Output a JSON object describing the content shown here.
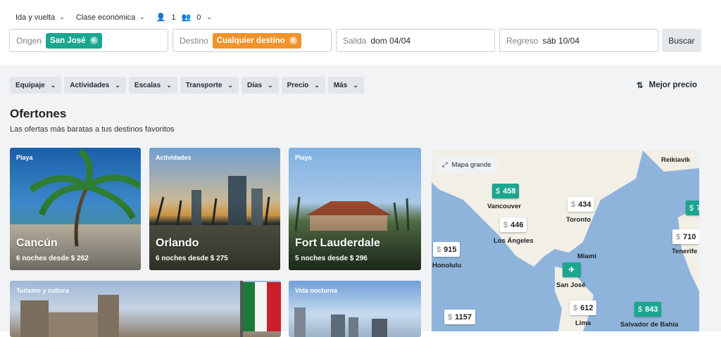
{
  "trip_options": {
    "trip_type": "Ida y vuelta",
    "cabin": "Clase económica",
    "adults": "1",
    "children": "0"
  },
  "search": {
    "origin": {
      "label": "Origen",
      "value": "San José",
      "color": "#1aa690"
    },
    "destination": {
      "label": "Destino",
      "value": "Cualquier destino",
      "color": "#f2922b"
    },
    "departure": {
      "label": "Salida",
      "value": "dom 04/04"
    },
    "return": {
      "label": "Regreso",
      "value": "sáb 10/04"
    },
    "button": "Buscar"
  },
  "filters": [
    "Equipaje",
    "Actividades",
    "Escalas",
    "Transporte",
    "Días",
    "Precio",
    "Más"
  ],
  "sort": "Mejor precio",
  "section": {
    "title": "Ofertones",
    "subtitle": "Las ofertas más baratas a tus destinos favoritos"
  },
  "cards": [
    {
      "category": "Playa",
      "city": "Cancún",
      "price": "6 noches desde $ 262"
    },
    {
      "category": "Actividades",
      "city": "Orlando",
      "price": "6 noches desde $ 275"
    },
    {
      "category": "Playa",
      "city": "Fort Lauderdale",
      "price": "5 noches desde $ 296"
    },
    {
      "category": "Turismo y cultura"
    },
    {
      "category": "Vida nocturna"
    }
  ],
  "map": {
    "button": "Mapa grande",
    "pins": [
      {
        "price": "458",
        "green": true
      },
      {
        "price": "434"
      },
      {
        "price": "446"
      },
      {
        "price": "915"
      },
      {
        "price": "7",
        "green": true
      },
      {
        "price": "710"
      },
      {
        "price": "612"
      },
      {
        "price": "843",
        "green": true
      },
      {
        "price": "1157"
      }
    ],
    "labels": [
      "Reikiavik",
      "Vancouver",
      "Toronto",
      "Los Ángeles",
      "Honolulu",
      "Miami",
      "San José",
      "Lima",
      "Salvador de Bahía",
      "Tenerife"
    ]
  }
}
